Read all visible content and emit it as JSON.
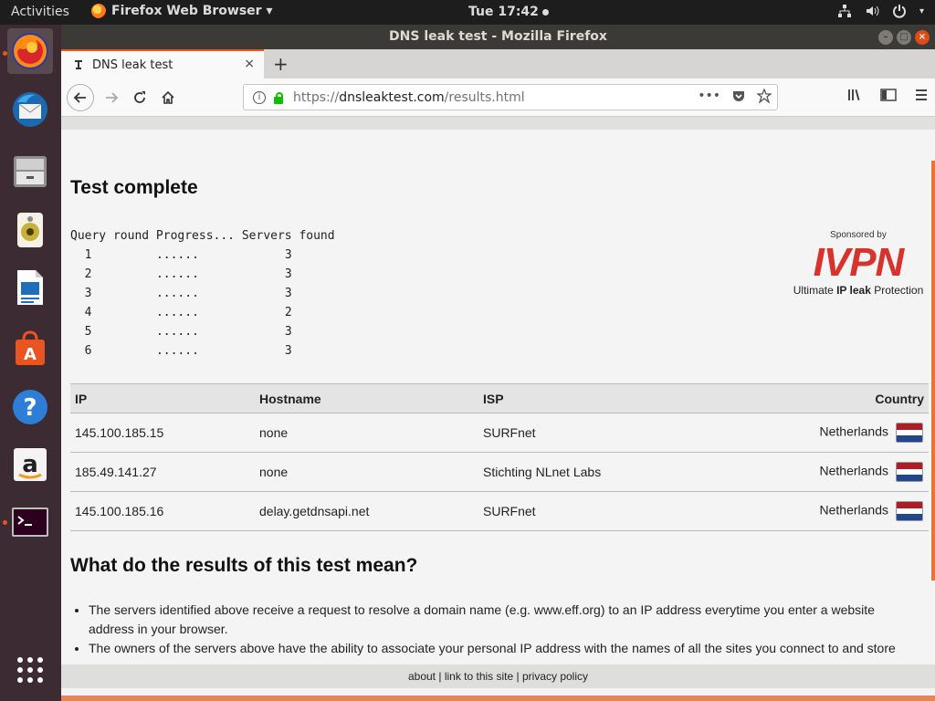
{
  "topbar": {
    "activities": "Activities",
    "app_menu": "Firefox Web Browser ▾",
    "clock": "Tue 17:42",
    "tray_icons": [
      "network-icon",
      "volume-icon",
      "power-icon"
    ]
  },
  "dock": {
    "items": [
      "firefox-icon",
      "thunderbird-icon",
      "files-icon",
      "rhythmbox-icon",
      "libreoffice-writer-icon",
      "ubuntu-software-icon",
      "help-icon",
      "amazon-icon",
      "terminal-icon",
      "show-apps-icon"
    ]
  },
  "window": {
    "title": "DNS leak test - Mozilla Firefox"
  },
  "tab": {
    "label": "DNS leak test",
    "close": "×",
    "new_tab": "+"
  },
  "nav": {
    "url_prefix": "https://",
    "url_host": "dnsleaktest.com",
    "url_path": "/results.html"
  },
  "page": {
    "heading": "Test complete",
    "progress_header": "Query round Progress... Servers found",
    "progress_rows": [
      {
        "round": "1",
        "progress": "......",
        "servers": "3"
      },
      {
        "round": "2",
        "progress": "......",
        "servers": "3"
      },
      {
        "round": "3",
        "progress": "......",
        "servers": "3"
      },
      {
        "round": "4",
        "progress": "......",
        "servers": "2"
      },
      {
        "round": "5",
        "progress": "......",
        "servers": "3"
      },
      {
        "round": "6",
        "progress": "......",
        "servers": "3"
      }
    ],
    "sponsor": {
      "sponsored_by": "Sponsored by",
      "logo": "IVPN",
      "tagline_pre": "Ultimate ",
      "tagline_bold": "IP leak",
      "tagline_post": " Protection"
    },
    "table": {
      "headers": {
        "ip": "IP",
        "hostname": "Hostname",
        "isp": "ISP",
        "country": "Country"
      },
      "rows": [
        {
          "ip": "145.100.185.15",
          "hostname": "none",
          "isp": "SURFnet",
          "country": "Netherlands"
        },
        {
          "ip": "185.49.141.27",
          "hostname": "none",
          "isp": "Stichting NLnet Labs",
          "country": "Netherlands"
        },
        {
          "ip": "145.100.185.16",
          "hostname": "delay.getdnsapi.net",
          "isp": "SURFnet",
          "country": "Netherlands"
        }
      ]
    },
    "meaning_heading": "What do the results of this test mean?",
    "bullets": [
      "The servers identified above receive a request to resolve a domain name (e.g. www.eff.org) to an IP address everytime you enter a website address in your browser.",
      "The owners of the servers above have the ability to associate your personal IP address with the names of all the sites you connect to and store"
    ],
    "footer": {
      "about": "about",
      "sep1": " | ",
      "link": "link to this site",
      "sep2": " | ",
      "privacy": "privacy policy"
    }
  },
  "colors": {
    "accent": "#e95420",
    "flag_red": "#ae1c28",
    "flag_white": "#ffffff",
    "flag_blue": "#21468b",
    "logo_red": "#d7332c"
  }
}
